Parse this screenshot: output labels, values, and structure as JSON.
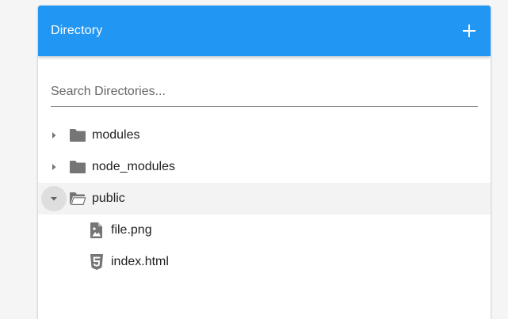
{
  "header": {
    "title": "Directory",
    "add_icon": "plus-icon"
  },
  "search": {
    "placeholder": "Search Directories...",
    "value": ""
  },
  "tree": {
    "items": [
      {
        "label": "modules",
        "icon": "folder-icon",
        "expanded": false
      },
      {
        "label": "node_modules",
        "icon": "folder-icon",
        "expanded": false
      },
      {
        "label": "public",
        "icon": "folder-open-icon",
        "expanded": true,
        "selected": true,
        "children": [
          {
            "label": "file.png",
            "icon": "image-file-icon"
          },
          {
            "label": "index.html",
            "icon": "html5-icon"
          }
        ]
      }
    ]
  },
  "colors": {
    "toolbar": "#2196f3",
    "icon": "#757575",
    "text": "#212121",
    "selected_row": "#f3f3f3"
  }
}
